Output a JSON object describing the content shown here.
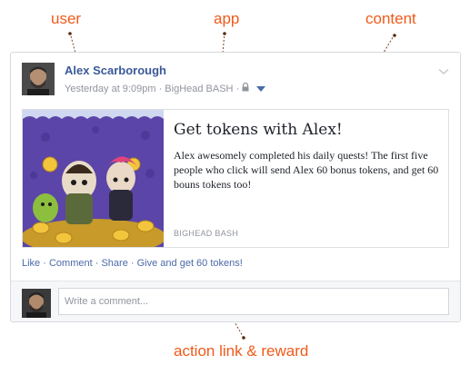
{
  "annotations": {
    "user": "user",
    "app": "app",
    "content": "content",
    "action": "action link & reward"
  },
  "post": {
    "author": "Alex Scarborough",
    "timestamp": "Yesterday at 9:09pm",
    "separator": "·",
    "app_name": "BigHead BASH",
    "privacy_icon": "lock-icon",
    "audience_icon": "caret-down-icon",
    "menu_icon": "chevron-down-icon"
  },
  "attachment": {
    "title": "Get tokens with Alex!",
    "description": "Alex awesomely completed his daily quests! The first five people who click will send Alex 60 bonus tokens, and get 60 bouns tokens too!",
    "source": "BIGHEAD BASH"
  },
  "actions": {
    "like": "Like",
    "comment": "Comment",
    "share": "Share",
    "reward": "Give and get 60 tokens!",
    "separator": "·"
  },
  "comment_box": {
    "placeholder": "Write a comment..."
  },
  "colors": {
    "annotation": "#f05a1a",
    "link": "#3b5998",
    "meta": "#90949c"
  }
}
